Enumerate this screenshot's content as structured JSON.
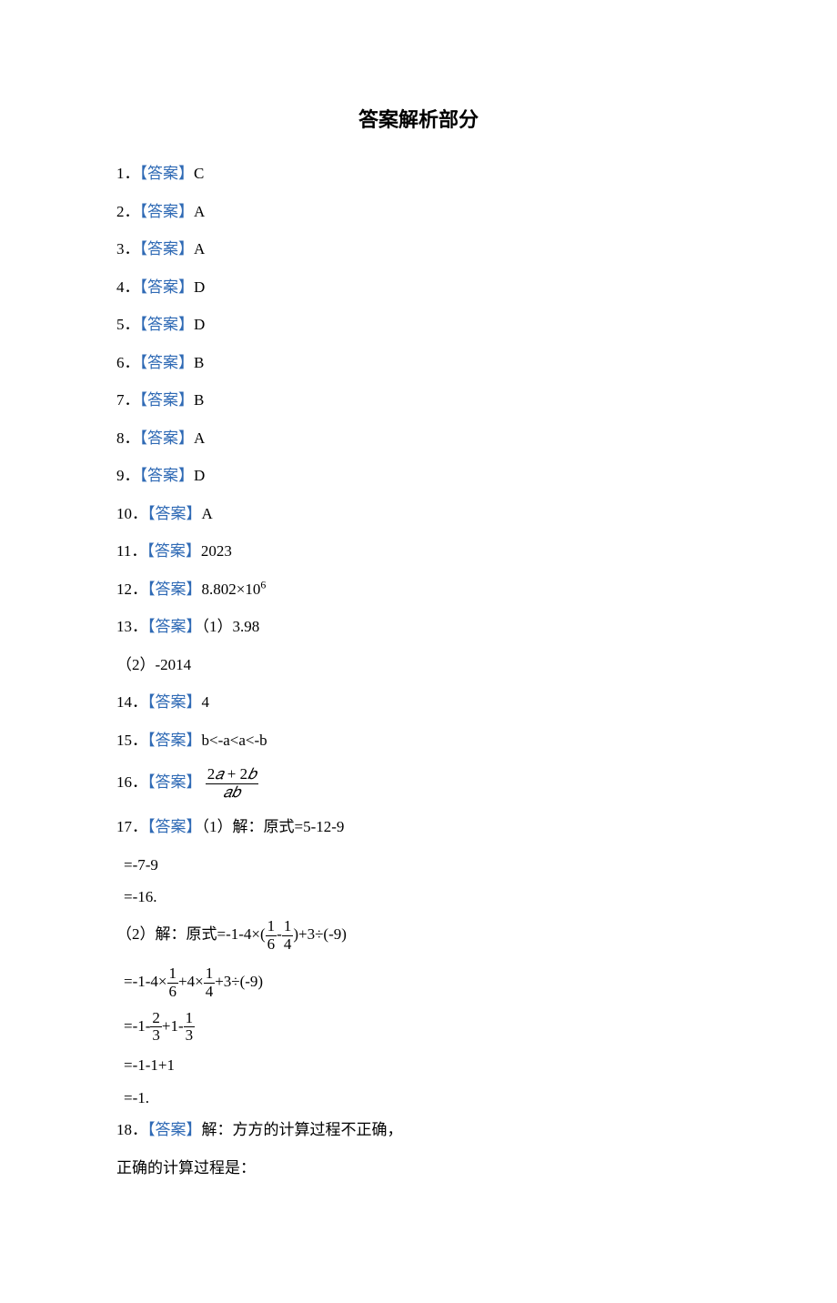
{
  "title": "答案解析部分",
  "label": "【答案】",
  "items": {
    "a1": {
      "num": "1．",
      "val": "C"
    },
    "a2": {
      "num": "2．",
      "val": "A"
    },
    "a3": {
      "num": "3．",
      "val": "A"
    },
    "a4": {
      "num": "4．",
      "val": "D"
    },
    "a5": {
      "num": "5．",
      "val": "D"
    },
    "a6": {
      "num": "6．",
      "val": "B"
    },
    "a7": {
      "num": "7．",
      "val": "B"
    },
    "a8": {
      "num": "8．",
      "val": "A"
    },
    "a9": {
      "num": "9．",
      "val": "D"
    },
    "a10": {
      "num": "10．",
      "val": "A"
    },
    "a11": {
      "num": "11．",
      "val": "2023"
    },
    "a12": {
      "num": "12．",
      "val_pre": "8.802×10",
      "val_sup": "6"
    },
    "a13": {
      "num": "13．",
      "part1_label": "（1）",
      "part1_val": "3.98",
      "part2_label": "（2）",
      "part2_val": "-2014"
    },
    "a14": {
      "num": "14．",
      "val": "4"
    },
    "a15": {
      "num": "15．",
      "val": "b<-a<a<-b"
    },
    "a16": {
      "num": "16．",
      "frac_top_a": "2",
      "frac_top_b": " + 2",
      "frac_bot": "𝑎𝑏"
    },
    "a17": {
      "num": "17．",
      "p1_lead": "（1）解：原式=5-12-9",
      "p1_s1": "=-7-9",
      "p1_s2": "=-16.",
      "p2_lead_a": "（2）解：原式=-1-4×(",
      "p2_lead_b": "-",
      "p2_lead_c": ")+3÷(-9)",
      "p2_s1_a": "=-1-4×",
      "p2_s1_b": "+4×",
      "p2_s1_c": "+3÷(-9)",
      "p2_s2_a": "=-1-",
      "p2_s2_b": "+1-",
      "p2_s3": "=-1-1+1",
      "p2_s4": "=-1.",
      "f1_6_top": "1",
      "f1_6_bot": "6",
      "f1_4_top": "1",
      "f1_4_bot": "4",
      "f2_3_top": "2",
      "f2_3_bot": "3",
      "f1_3_top": "1",
      "f1_3_bot": "3"
    },
    "a18": {
      "num": "18．",
      "line1": "解：方方的计算过程不正确，",
      "line2": "正确的计算过程是："
    }
  }
}
